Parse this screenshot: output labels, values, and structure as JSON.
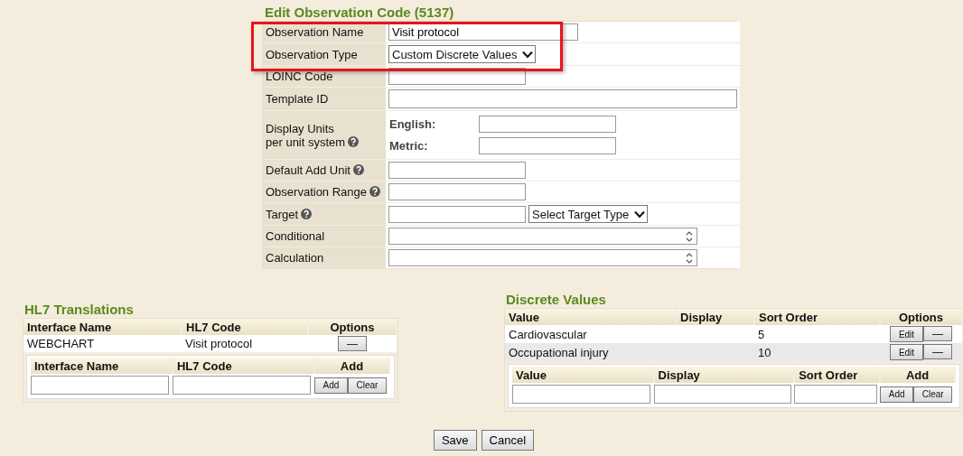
{
  "form": {
    "title": "Edit Observation Code (5137)",
    "highlighted_rows": [
      {
        "kind": "text",
        "label": "Observation Name",
        "value": "Visit protocol",
        "help": false
      },
      {
        "kind": "select",
        "label": "Observation Type",
        "value": "Custom Discrete Values",
        "help": false
      }
    ],
    "rows": [
      {
        "kind": "short",
        "label": "LOINC Code",
        "help": false
      },
      {
        "kind": "textarea",
        "label": "Template ID",
        "help": false
      },
      {
        "kind": "units",
        "label": "Display Units\nper unit system",
        "help": true,
        "units": [
          "English:",
          "Metric:"
        ]
      },
      {
        "kind": "short",
        "label": "Default Add Unit",
        "help": true
      },
      {
        "kind": "short",
        "label": "Observation Range",
        "help": true
      },
      {
        "kind": "target",
        "label": "Target",
        "help": true,
        "select": "Select Target Type"
      },
      {
        "kind": "spinner",
        "label": "Conditional",
        "help": false
      },
      {
        "kind": "spinner",
        "label": "Calculation",
        "help": false
      }
    ]
  },
  "hl7": {
    "title": "HL7 Translations",
    "columns": [
      "Interface Name",
      "HL7 Code",
      "Options"
    ],
    "rows": [
      {
        "interface": "WEBCHART",
        "code": "Visit protocol",
        "remove": "—"
      }
    ],
    "add_form": {
      "columns": [
        "Interface Name",
        "HL7 Code",
        "Add"
      ],
      "buttons": [
        "Add",
        "Clear"
      ]
    }
  },
  "discrete": {
    "title": "Discrete Values",
    "columns": [
      "Value",
      "Display",
      "Sort Order",
      "Options"
    ],
    "rows": [
      {
        "value": "Cardiovascular",
        "sort_order": "5",
        "edit": "Edit",
        "remove": "—"
      },
      {
        "value": "Occupational injury",
        "sort_order": "10",
        "edit": "Edit",
        "remove": "—"
      }
    ],
    "add_form": {
      "columns": [
        "Value",
        "Display",
        "Sort Order",
        "Add"
      ],
      "buttons": [
        "Add",
        "Clear"
      ]
    }
  },
  "buttons": [
    "Save",
    "Cancel"
  ]
}
